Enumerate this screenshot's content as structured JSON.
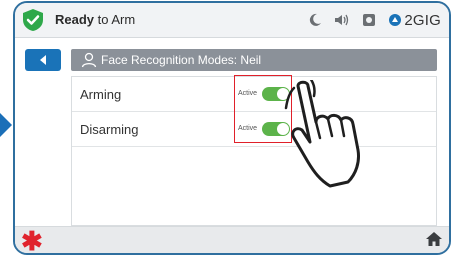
{
  "header": {
    "status_bold": "Ready",
    "status_rest": " to Arm",
    "brand": "2GIG",
    "icons": [
      "moon-icon",
      "speaker-icon",
      "camera-icon",
      "2gig-logo"
    ]
  },
  "nav": {
    "back_icon": "chevron-left-icon"
  },
  "title_bar": {
    "icon": "user-icon",
    "title": "Face Recognition Modes: Neil"
  },
  "settings": [
    {
      "label": "Arming",
      "state": "Active",
      "enabled": true
    },
    {
      "label": "Disarming",
      "state": "Active",
      "enabled": true
    }
  ],
  "footer": {
    "left_icon": "emergency-asterisk-icon",
    "right_icon": "home-icon"
  },
  "colors": {
    "accent": "#1a73b8",
    "toggle_on": "#5cb34a",
    "highlight": "#e0202a",
    "shield": "#2ea84a"
  }
}
